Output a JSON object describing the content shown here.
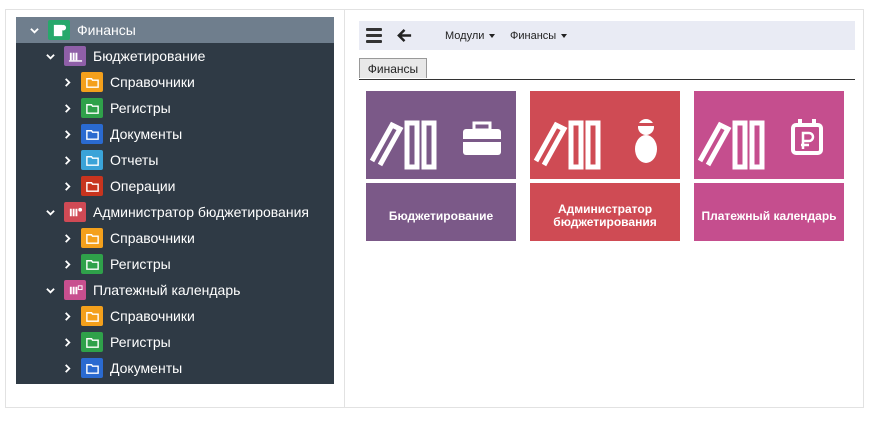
{
  "sidebar": {
    "root": {
      "label": "Финансы"
    },
    "groups": [
      {
        "label": "Бюджетирование",
        "color": "#8f5fa8",
        "items": [
          {
            "label": "Справочники",
            "color": "#f4a01c"
          },
          {
            "label": "Регистры",
            "color": "#2fa14a"
          },
          {
            "label": "Документы",
            "color": "#2a6ad0"
          },
          {
            "label": "Отчеты",
            "color": "#3aa3d8"
          },
          {
            "label": "Операции",
            "color": "#c8341e"
          }
        ]
      },
      {
        "label": "Администратор бюджетирования",
        "color": "#d04a55",
        "items": [
          {
            "label": "Справочники",
            "color": "#f4a01c"
          },
          {
            "label": "Регистры",
            "color": "#2fa14a"
          }
        ]
      },
      {
        "label": "Платежный календарь",
        "color": "#c84f8f",
        "items": [
          {
            "label": "Справочники",
            "color": "#f4a01c"
          },
          {
            "label": "Регистры",
            "color": "#2fa14a"
          },
          {
            "label": "Документы",
            "color": "#2a6ad0"
          }
        ]
      }
    ]
  },
  "toolbar": {
    "menus": [
      {
        "label": "Модули"
      },
      {
        "label": "Финансы"
      }
    ]
  },
  "tabs": [
    {
      "label": "Финансы"
    }
  ],
  "tiles": [
    {
      "label_line1": "Бюджетирование",
      "label_line2": "",
      "color": "#7b5988",
      "badge_icon": "briefcase-icon"
    },
    {
      "label_line1": "Администратор",
      "label_line2": "бюджетирования",
      "color": "#cf4b54",
      "badge_icon": "person-icon"
    },
    {
      "label_line1": "Платежный календарь",
      "label_line2": "",
      "color": "#c54e8e",
      "badge_icon": "ruble-calendar-icon"
    }
  ],
  "colors": {
    "sidebar_bg": "#2f3a45",
    "root_bg": "#6f7e8d",
    "toolbar_bg": "#e9ebf4"
  }
}
